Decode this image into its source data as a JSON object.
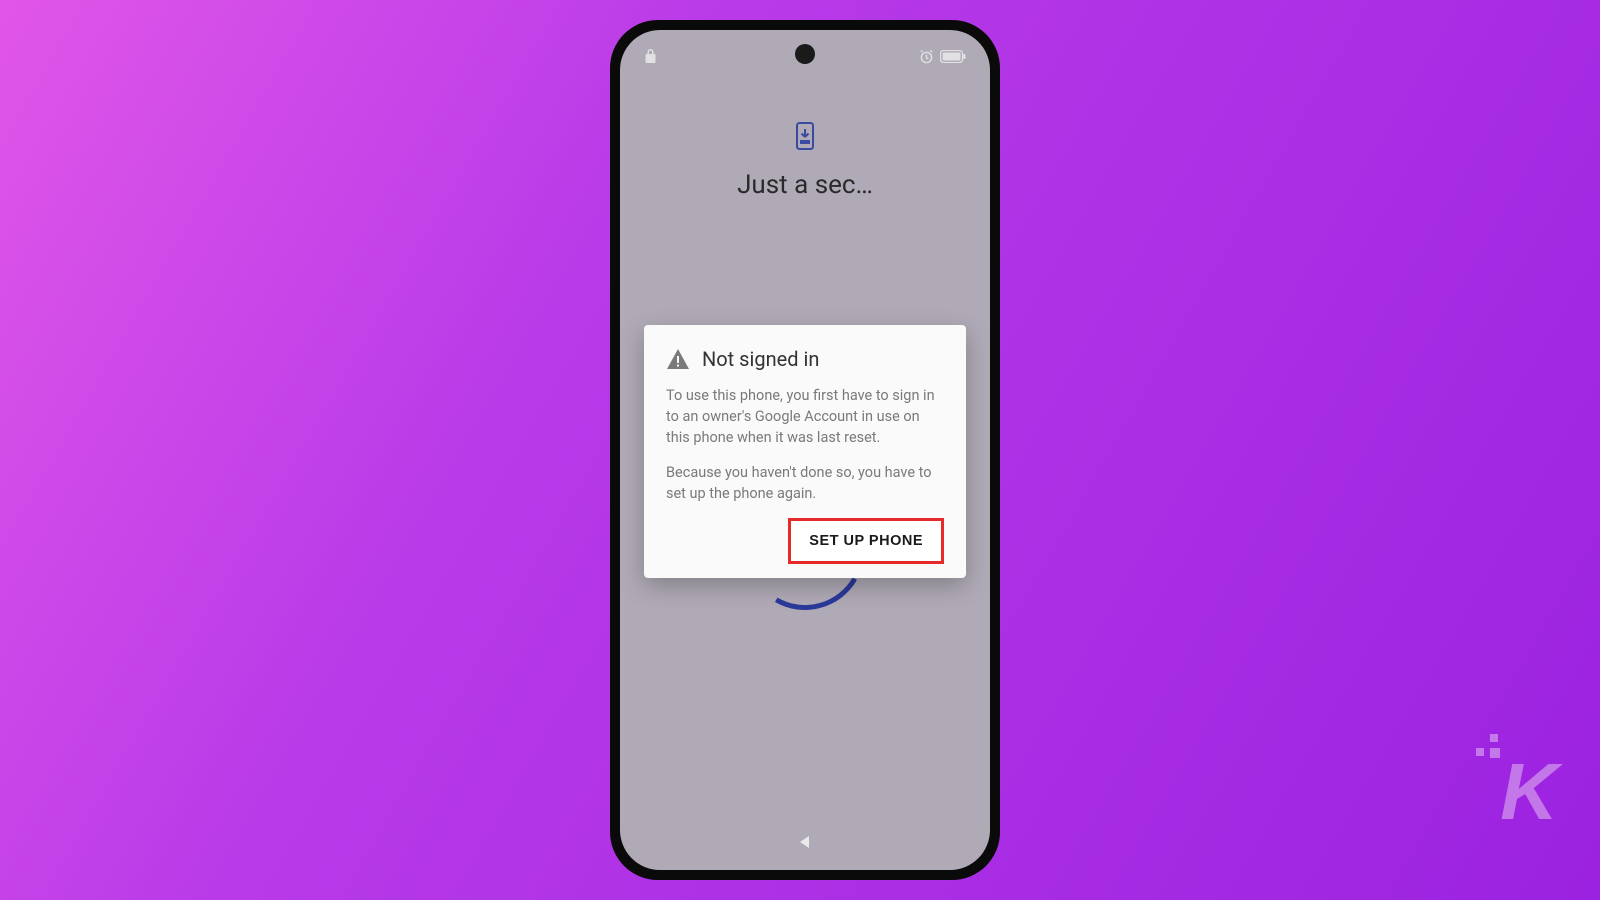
{
  "page": {
    "title": "Just a sec…"
  },
  "dialog": {
    "title": "Not signed in",
    "body1": "To use this phone, you first have to sign in to an owner's Google Account in use on this phone when it was last reset.",
    "body2": "Because you haven't done so, you have to set up the phone again.",
    "action_label": "SET UP PHONE"
  },
  "watermark": {
    "letter": "K"
  }
}
